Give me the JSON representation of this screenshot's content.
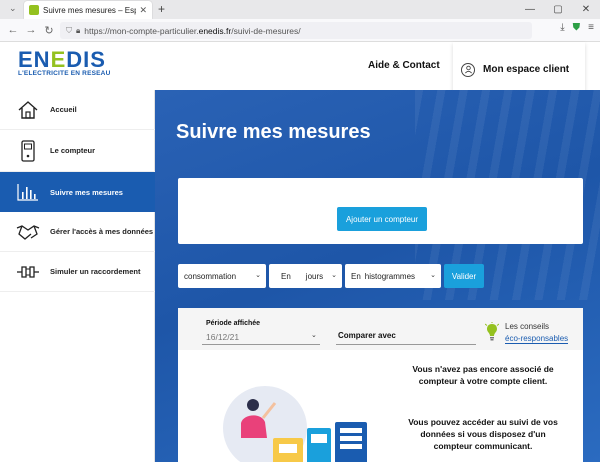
{
  "browser": {
    "tab_title": "Suivre mes mesures – Espace P",
    "url_prefix": "https://mon-compte-particulier.",
    "url_domain": "enedis.fr",
    "url_path": "/suivi-de-mesures/"
  },
  "header": {
    "logo_a": "EN",
    "logo_b": "E",
    "logo_c": "DIS",
    "logo_tagline": "L'ELECTRICITE EN RESEAU",
    "help_link": "Aide & Contact",
    "account_label": "Mon espace client"
  },
  "sidebar": {
    "items": [
      {
        "label": "Accueil",
        "icon": "home-icon"
      },
      {
        "label": "Le compteur",
        "icon": "meter-icon"
      },
      {
        "label": "Suivre mes mesures",
        "icon": "chart-icon",
        "active": true
      },
      {
        "label": "Gérer l'accès à mes données",
        "icon": "handshake-icon"
      },
      {
        "label": "Simuler un raccordement",
        "icon": "plug-icon"
      }
    ]
  },
  "main": {
    "title": "Suivre mes mesures",
    "add_meter_button": "Ajouter un compteur",
    "filters": {
      "measure": "consommation",
      "unit_prefix": "En",
      "unit": "jours",
      "view_prefix": "En",
      "view": "histogrammes",
      "submit": "Valider"
    },
    "panel": {
      "period_label": "Période affichée",
      "period_value": "16/12/21",
      "compare_label": "Comparer avec",
      "tips_line1": "Les conseils",
      "tips_line2": "éco-responsables",
      "message1": "Vous n'avez pas encore associé de compteur à votre compte client.",
      "message2": "Vous pouvez accéder au suivi de vos données si vous disposez d'un compteur communicant."
    }
  },
  "colors": {
    "brand_blue": "#1a5cb0",
    "brand_green": "#94c11f",
    "action_blue": "#1aa0dc"
  }
}
